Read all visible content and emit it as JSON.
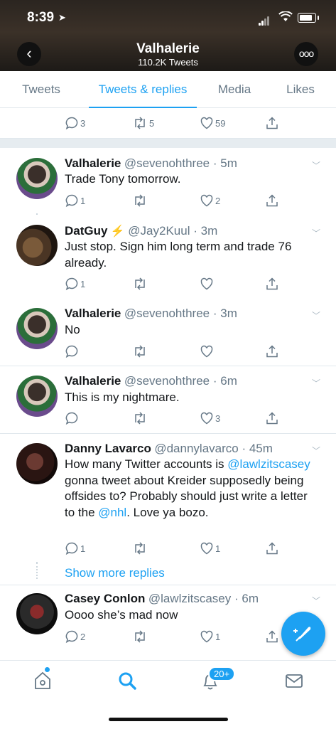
{
  "status_bar": {
    "time": "8:39"
  },
  "header": {
    "title": "Valhalerie",
    "subtitle": "110.2K Tweets"
  },
  "tabs": [
    {
      "label": "Tweets"
    },
    {
      "label": "Tweets & replies"
    },
    {
      "label": "Media"
    },
    {
      "label": "Likes"
    }
  ],
  "partial_tweet": {
    "replies": "3",
    "retweets": "5",
    "likes": "59"
  },
  "tweets": [
    {
      "name": "Valhalerie",
      "handle": "@sevenohthree",
      "time": "5m",
      "text": "Trade Tony tomorrow.",
      "replies": "1",
      "retweets": "",
      "likes": "2"
    },
    {
      "name": "DatGuy",
      "name_emoji": "⚡",
      "handle": "@Jay2Kuul",
      "time": "3m",
      "text": "Just stop. Sign him long term and trade 76 already.",
      "replies": "1",
      "retweets": "",
      "likes": ""
    },
    {
      "name": "Valhalerie",
      "handle": "@sevenohthree",
      "time": "3m",
      "text": "No",
      "replies": "",
      "retweets": "",
      "likes": ""
    },
    {
      "name": "Valhalerie",
      "handle": "@sevenohthree",
      "time": "6m",
      "text": "This is my nightmare.",
      "replies": "",
      "retweets": "",
      "likes": "3"
    },
    {
      "name": "Danny Lavarco",
      "handle": "@dannylavarco",
      "time": "45m",
      "text_part1": "How many Twitter  accounts is ",
      "mention1": "@lawlzitscasey",
      "text_part2": " gonna tweet about Kreider supposedly being offsides to? Probably should just write a letter to the ",
      "mention2": "@nhl",
      "text_part3": ". Love ya bozo.",
      "replies": "1",
      "retweets": "",
      "likes": "1"
    },
    {
      "name": "Casey Conlon",
      "handle": "@lawlzitscasey",
      "time": "6m",
      "text": "Oooo she’s mad now",
      "replies": "2",
      "retweets": "",
      "likes": "1"
    }
  ],
  "show_more": "Show more replies",
  "bottom_nav": {
    "notifications_badge": "20+"
  },
  "colors": {
    "accent": "#1da1f2",
    "muted": "#657786",
    "divider": "#e1e8ed"
  },
  "icons": [
    "back-icon",
    "more-icon",
    "reply-icon",
    "retweet-icon",
    "like-icon",
    "share-icon",
    "chevron-down-icon",
    "compose-icon",
    "home-icon",
    "search-icon",
    "notifications-icon",
    "messages-icon"
  ]
}
